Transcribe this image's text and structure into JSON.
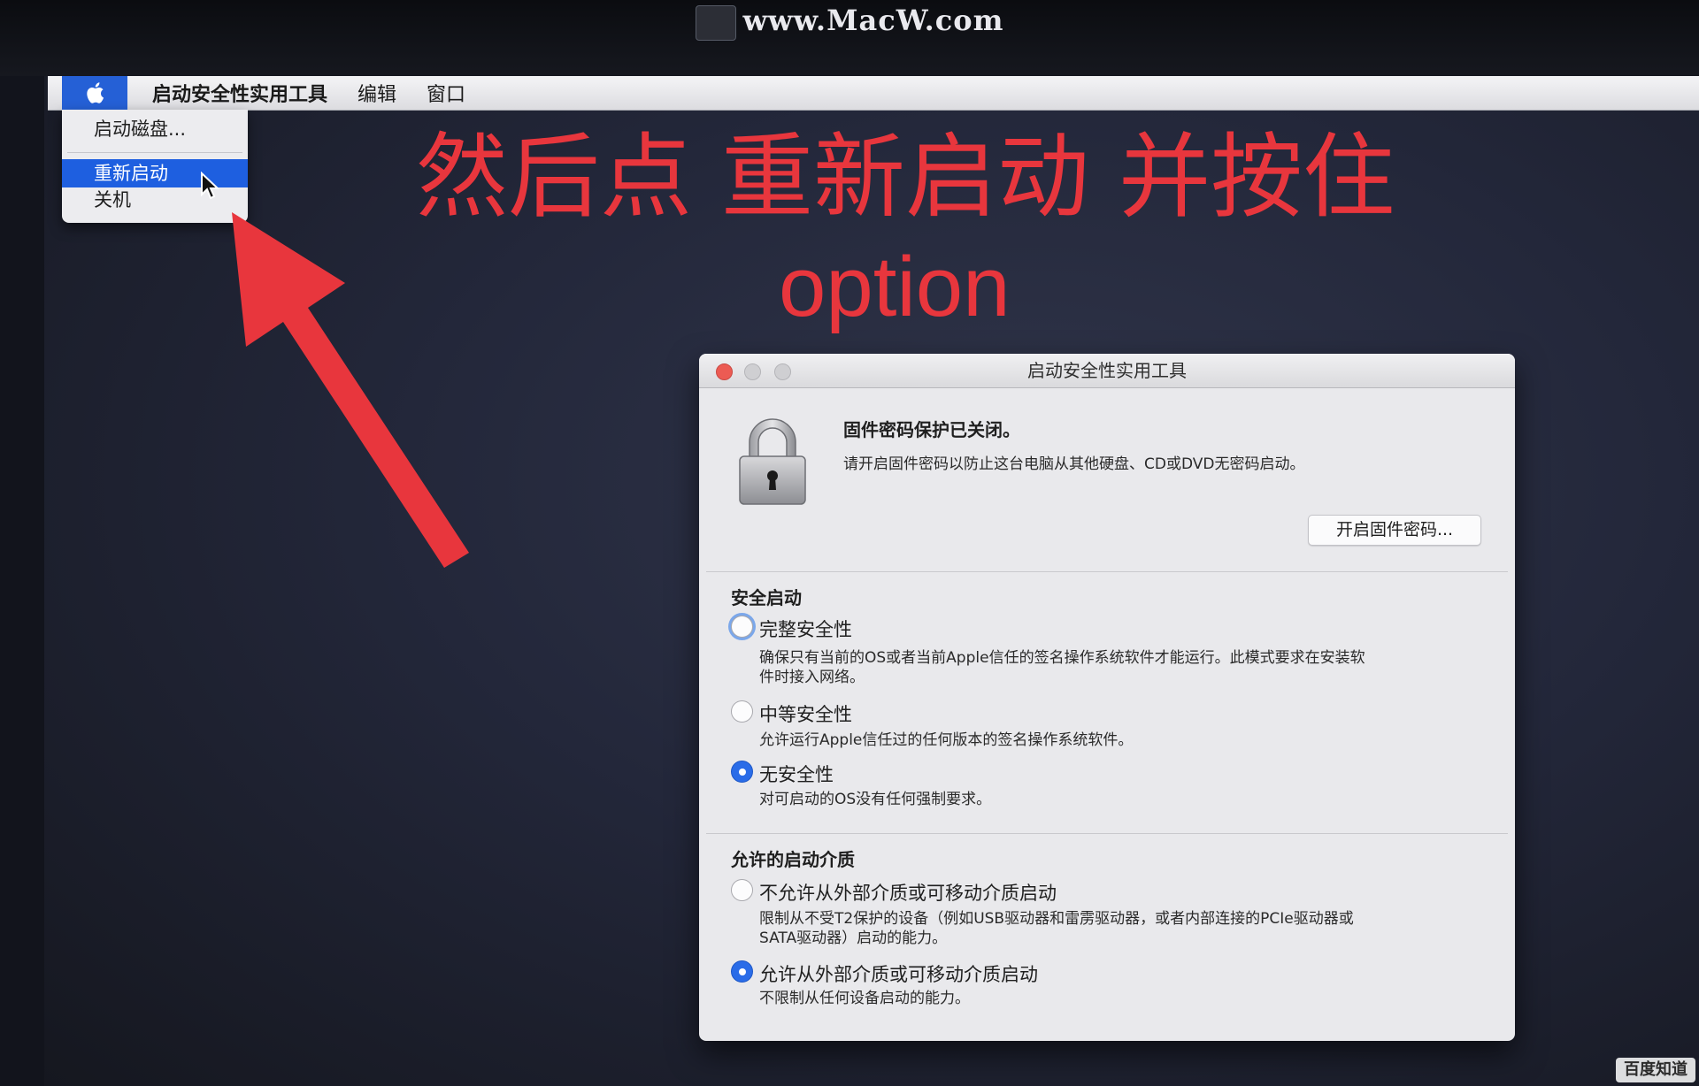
{
  "watermark_top": "www.MacW.com",
  "watermark_bottom": "百度知道",
  "menubar": {
    "app_name": "启动安全性实用工具",
    "menus": [
      "编辑",
      "窗口"
    ]
  },
  "apple_menu": {
    "items": [
      "启动磁盘...",
      "重新启动",
      "关机"
    ],
    "highlighted": "重新启动"
  },
  "instruction": {
    "line1": "然后点 重新启动 并按住",
    "line2": "option",
    "color": "#e8363d"
  },
  "window": {
    "title": "启动安全性实用工具",
    "firmware": {
      "title": "固件密码保护已关闭。",
      "description": "请开启固件密码以防止这台电脑从其他硬盘、CD或DVD无密码启动。",
      "button": "开启固件密码..."
    },
    "secure_boot": {
      "title": "安全启动",
      "options": [
        {
          "label": "完整安全性",
          "desc_lines": [
            "确保只有当前的OS或者当前Apple信任的签名操作系统软件才能运行。此模式要求在安装软",
            "件时接入网络。"
          ],
          "selected": false
        },
        {
          "label": "中等安全性",
          "desc_lines": [
            "允许运行Apple信任过的任何版本的签名操作系统软件。"
          ],
          "selected": false
        },
        {
          "label": "无安全性",
          "desc_lines": [
            "对可启动的OS没有任何强制要求。"
          ],
          "selected": true
        }
      ]
    },
    "boot_media": {
      "title": "允许的启动介质",
      "options": [
        {
          "label": "不允许从外部介质或可移动介质启动",
          "desc_lines": [
            "限制从不受T2保护的设备（例如USB驱动器和雷雳驱动器，或者内部连接的PCIe驱动器或",
            "SATA驱动器）启动的能力。"
          ],
          "selected": false
        },
        {
          "label": "允许从外部介质或可移动介质启动",
          "desc_lines": [
            "不限制从任何设备启动的能力。"
          ],
          "selected": true
        }
      ]
    }
  }
}
